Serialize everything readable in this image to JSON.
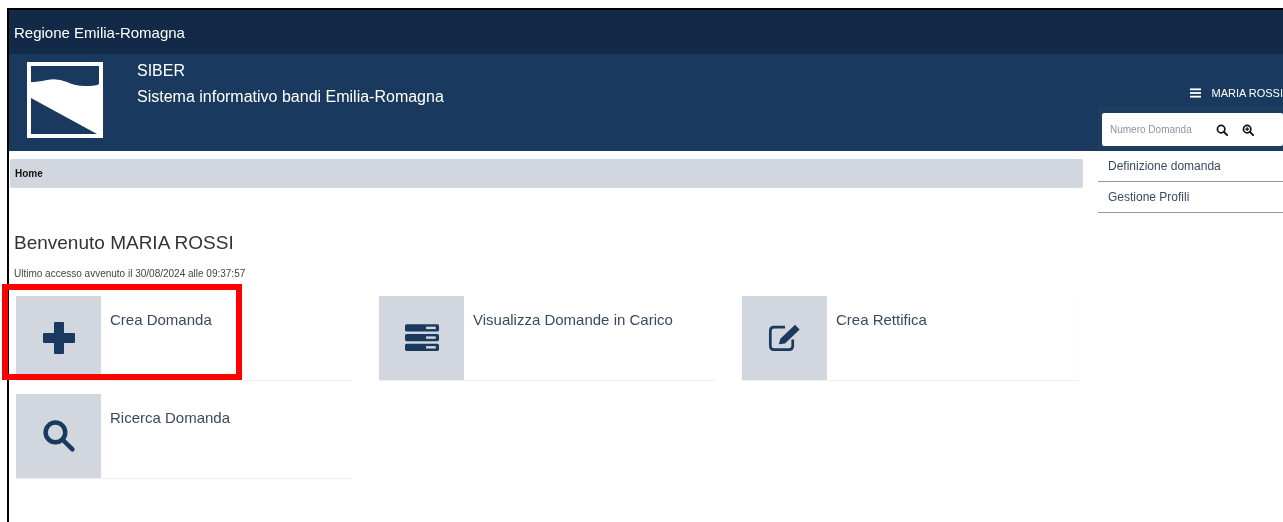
{
  "top_bar": {
    "title": "Regione Emilia-Romagna"
  },
  "header": {
    "app_name": "SIBER",
    "subtitle": "Sistema informativo bandi Emilia-Romagna",
    "user": "MARIA ROSSI",
    "search": {
      "placeholder": "Numero Domanda"
    }
  },
  "breadcrumb": [
    "Home"
  ],
  "side_menu": [
    {
      "label": "Definizione domanda"
    },
    {
      "label": "Gestione Profili"
    }
  ],
  "welcome": "Benvenuto MARIA ROSSI",
  "last_access": "Ultimo accesso avvenuto il 30/08/2024 alle 09:37:57",
  "tiles": [
    {
      "label": "Crea Domanda",
      "kind": "plus",
      "highlighted": true
    },
    {
      "label": "Visualizza Domande in Carico",
      "kind": "list",
      "highlighted": false
    },
    {
      "label": "Crea Rettifica",
      "kind": "edit",
      "highlighted": false
    },
    {
      "label": "Ricerca Domanda",
      "kind": "search",
      "highlighted": false
    }
  ]
}
